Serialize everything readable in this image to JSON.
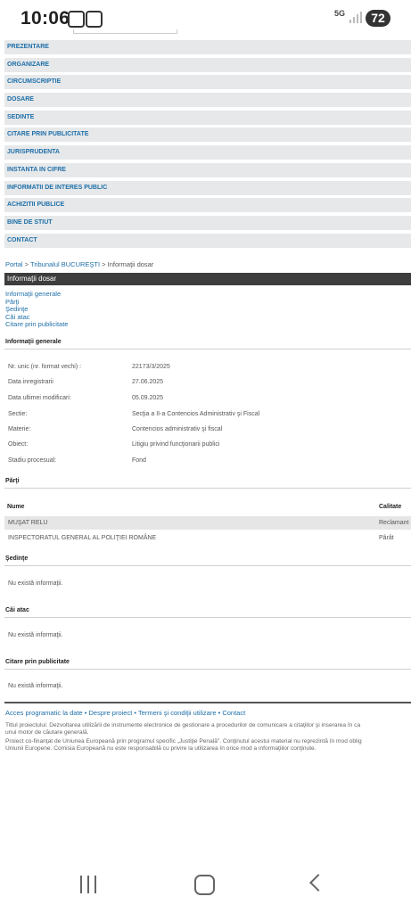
{
  "status": {
    "time": "10:06",
    "network": "5G",
    "battery": "72"
  },
  "menu": [
    "PREZENTARE",
    "ORGANIZARE",
    "CIRCUMSCRIPTIE",
    "DOSARE",
    "SEDINTE",
    "CITARE PRIN PUBLICITATE",
    "JURISPRUDENTA",
    "INSTANTA IN CIFRE",
    "INFORMATII DE INTERES PUBLIC",
    "ACHIZITII PUBLICE",
    "BINE DE STIUT",
    "CONTACT"
  ],
  "breadcrumb": {
    "portal": "Portal",
    "sep1": " > ",
    "court": "Tribunalul BUCUREŞTI",
    "sep2": " > ",
    "current": "Informaţii dosar"
  },
  "section_title": "Informaţii dosar",
  "sublinks": [
    "Informaţii generale",
    "Părţi",
    "Şedinţe",
    "Căi atac",
    "Citare prin publicitate"
  ],
  "general": {
    "heading": "Informaţii generale",
    "rows": [
      {
        "label": "Nr. unic (nr. format vechi) :",
        "value": "22173/3/2025"
      },
      {
        "label": "Data inregistrarii",
        "value": "27.06.2025"
      },
      {
        "label": "Data ultimei modificari:",
        "value": "05.09.2025"
      },
      {
        "label": "Sectie:",
        "value": "Secţia a II-a Contencios Administrativ şi Fiscal"
      },
      {
        "label": "Materie:",
        "value": "Contencios administrativ şi fiscal"
      },
      {
        "label": "Obiect:",
        "value": "Litigiu privind funcţionarii publici"
      },
      {
        "label": "Stadiu procesual:",
        "value": "Fond"
      }
    ]
  },
  "parti": {
    "heading": "Părţi",
    "columns": [
      "Nume",
      "Calitate"
    ],
    "rows": [
      {
        "name": "MUŞAT RELU",
        "role": "Reclamant"
      },
      {
        "name": "INSPECTORATUL GENERAL AL POLIŢIEI ROMÂNE",
        "role": "Pârât"
      }
    ]
  },
  "sedinte": {
    "heading": "Şedinţe",
    "empty": "Nu există informaţii."
  },
  "cai_atac": {
    "heading": "Căi atac",
    "empty": "Nu există informaţii."
  },
  "citare": {
    "heading": "Citare prin publicitate",
    "empty": "Nu există informaţii."
  },
  "footer": {
    "links": [
      "Acces programatic la date",
      "Despre proiect",
      "Termeni şi condiţii utilizare",
      "Contact"
    ],
    "separator": " • ",
    "lines": [
      "Titlul proiectului: Dezvoltarea utilizării de instrumente electronice de gestionare a procedurilor de comunicare a citaţiilor şi inserarea în ca",
      "unui motor de căutare generală.",
      "Proiect co-finanţat de Uniunea Europeană prin programul specific „Justiţie Penală\". Conţinutul acestui material nu reprezintă în mod oblig",
      "Uniunii Europene. Comisia Europeană nu este responsabilă cu privire la utilizarea în orice mod a informaţiilor conţinute."
    ]
  }
}
